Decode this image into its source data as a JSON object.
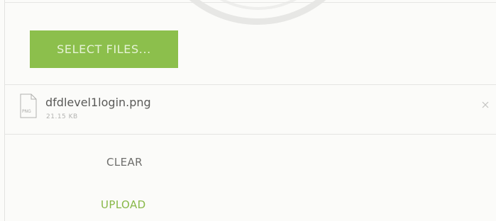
{
  "uploader": {
    "select_label": "SELECT FILES...",
    "accent_color": "#8cbf4c",
    "files": [
      {
        "name": "dfdlevel1login.png",
        "size": "21.15 KB",
        "icon": "png-file-icon",
        "icon_badge": "PNG"
      }
    ],
    "remove_icon": "close-icon",
    "clear_label": "CLEAR",
    "upload_label": "UPLOAD"
  }
}
